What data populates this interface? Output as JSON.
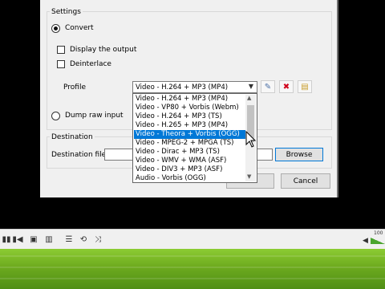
{
  "settings": {
    "group_label": "Settings",
    "convert_label": "Convert",
    "display_output_label": "Display the output",
    "deinterlace_label": "Deinterlace",
    "profile_label": "Profile",
    "profile_selected": "Video - H.264 + MP3 (MP4)",
    "dump_raw_label": "Dump raw input"
  },
  "profile_options": [
    "Video - H.264 + MP3 (MP4)",
    "Video - VP80 + Vorbis (Webm)",
    "Video - H.264 + MP3 (TS)",
    "Video - H.265 + MP3 (MP4)",
    "Video - Theora + Vorbis (OGG)",
    "Video - MPEG-2 + MPGA (TS)",
    "Video - Dirac + MP3 (TS)",
    "Video - WMV + WMA (ASF)",
    "Video - DIV3 + MP3 (ASF)",
    "Audio - Vorbis (OGG)"
  ],
  "highlighted_option_index": 4,
  "destination": {
    "group_label": "Destination",
    "file_label": "Destination file:",
    "file_value": "",
    "browse_label": "Browse"
  },
  "buttons": {
    "cancel_label": "Cancel"
  },
  "player": {
    "volume_text": "100"
  },
  "colors": {
    "selection": "#0078d7",
    "delete_icon": "#d0021b"
  }
}
